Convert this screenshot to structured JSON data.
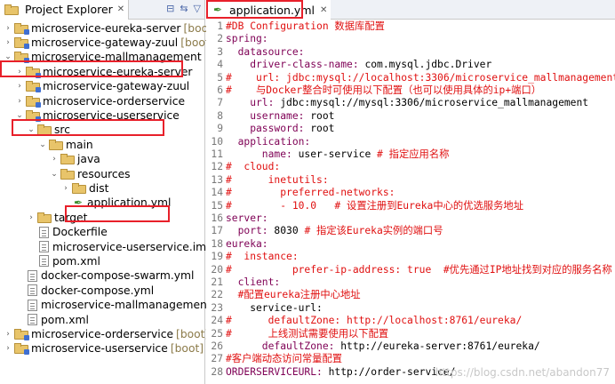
{
  "explorer": {
    "title": "Project Explorer",
    "close": "✕",
    "items": [
      {
        "label": "microservice-eureka-server",
        "suffix": "[boot]",
        "type": "proj",
        "level": 0,
        "twist": "›"
      },
      {
        "label": "microservice-gateway-zuul",
        "suffix": "[boot]",
        "type": "proj",
        "level": 0,
        "twist": "›"
      },
      {
        "label": "microservice-mallmanagement",
        "suffix": "",
        "type": "proj",
        "level": 0,
        "twist": "⌄"
      },
      {
        "label": "microservice-eureka-server",
        "suffix": "",
        "type": "proj",
        "level": 1,
        "twist": "›"
      },
      {
        "label": "microservice-gateway-zuul",
        "suffix": "",
        "type": "proj",
        "level": 1,
        "twist": "›"
      },
      {
        "label": "microservice-orderservice",
        "suffix": "",
        "type": "proj",
        "level": 1,
        "twist": "›"
      },
      {
        "label": "microservice-userservice",
        "suffix": "",
        "type": "proj",
        "level": 1,
        "twist": "⌄"
      },
      {
        "label": "src",
        "suffix": "",
        "type": "folder",
        "level": 2,
        "twist": "⌄"
      },
      {
        "label": "main",
        "suffix": "",
        "type": "folder",
        "level": 3,
        "twist": "⌄"
      },
      {
        "label": "java",
        "suffix": "",
        "type": "folder",
        "level": 4,
        "twist": "›"
      },
      {
        "label": "resources",
        "suffix": "",
        "type": "folder",
        "level": 4,
        "twist": "⌄"
      },
      {
        "label": "dist",
        "suffix": "",
        "type": "folder",
        "level": 5,
        "twist": "›"
      },
      {
        "label": "application.yml",
        "suffix": "",
        "type": "yml",
        "level": 5,
        "twist": ""
      },
      {
        "label": "target",
        "suffix": "",
        "type": "folder",
        "level": 2,
        "twist": "›"
      },
      {
        "label": "Dockerfile",
        "suffix": "",
        "type": "file",
        "level": 2,
        "twist": ""
      },
      {
        "label": "microservice-userservice.iml",
        "suffix": "",
        "type": "file",
        "level": 2,
        "twist": ""
      },
      {
        "label": "pom.xml",
        "suffix": "",
        "type": "file",
        "level": 2,
        "twist": ""
      },
      {
        "label": "docker-compose-swarm.yml",
        "suffix": "",
        "type": "file",
        "level": 1,
        "twist": ""
      },
      {
        "label": "docker-compose.yml",
        "suffix": "",
        "type": "file",
        "level": 1,
        "twist": ""
      },
      {
        "label": "microservice-mallmanagement.iml",
        "suffix": "",
        "type": "file",
        "level": 1,
        "twist": ""
      },
      {
        "label": "pom.xml",
        "suffix": "",
        "type": "file",
        "level": 1,
        "twist": ""
      },
      {
        "label": "microservice-orderservice",
        "suffix": "[boot]",
        "type": "proj",
        "level": 0,
        "twist": "›"
      },
      {
        "label": "microservice-userservice",
        "suffix": "[boot]",
        "type": "proj",
        "level": 0,
        "twist": "›"
      }
    ]
  },
  "editor": {
    "tab_label": "application.yml",
    "close": "✕",
    "lines": [
      [
        [
          "#DB Configuration 数据库配置",
          "red"
        ]
      ],
      [
        [
          "spring:",
          "key"
        ]
      ],
      [
        [
          "  datasource:",
          "key"
        ]
      ],
      [
        [
          "    driver-class-name: ",
          "key"
        ],
        [
          "com.mysql.jdbc.Driver",
          "plain"
        ]
      ],
      [
        [
          "#    url: jdbc:mysql://localhost:3306/microservice_mallmanagement",
          "red"
        ]
      ],
      [
        [
          "#    与Docker整合时可使用以下配置（也可以使用具体的ip+端口）",
          "red"
        ]
      ],
      [
        [
          "    url: ",
          "key"
        ],
        [
          "jdbc:mysql://mysql:3306/microservice_mallmanagement",
          "plain"
        ]
      ],
      [
        [
          "    username: ",
          "key"
        ],
        [
          "root",
          "plain"
        ]
      ],
      [
        [
          "    password: ",
          "key"
        ],
        [
          "root",
          "plain"
        ]
      ],
      [
        [
          "  application:",
          "key"
        ]
      ],
      [
        [
          "      name: ",
          "key"
        ],
        [
          "user-service ",
          "plain"
        ],
        [
          "# 指定应用名称",
          "red"
        ]
      ],
      [
        [
          "#  cloud:",
          "red"
        ]
      ],
      [
        [
          "#      inetutils:",
          "red"
        ]
      ],
      [
        [
          "#        preferred-networks:",
          "red"
        ]
      ],
      [
        [
          "#        - 10.0   # 设置注册到Eureka中心的优选服务地址",
          "red"
        ]
      ],
      [
        [
          "server:",
          "key"
        ]
      ],
      [
        [
          "  port: ",
          "key"
        ],
        [
          "8030 ",
          "plain"
        ],
        [
          "# 指定该Eureka实例的端口号",
          "red"
        ]
      ],
      [
        [
          "eureka:",
          "key"
        ]
      ],
      [
        [
          "#  instance:",
          "red"
        ]
      ],
      [
        [
          "#          prefer-ip-address: true  #优先通过IP地址找到对应的服务名称",
          "red"
        ]
      ],
      [
        [
          "  client:",
          "key"
        ]
      ],
      [
        [
          "  #配置eureka注册中心地址",
          "red"
        ]
      ],
      [
        [
          "    service-url:",
          "plain"
        ]
      ],
      [
        [
          "#      defaultZone: http://localhost:8761/eureka/",
          "red"
        ]
      ],
      [
        [
          "#      上线测试需要使用以下配置",
          "red"
        ]
      ],
      [
        [
          "      defaultZone: ",
          "key"
        ],
        [
          "http://eureka-server:8761/eureka/",
          "plain"
        ]
      ],
      [
        [
          "#客户端动态访问常量配置",
          "red"
        ]
      ],
      [
        [
          "ORDERSERVICEURL: ",
          "key"
        ],
        [
          "http://order-service/",
          "plain"
        ]
      ]
    ]
  },
  "watermark": "https://blog.csdn.net/abandon77",
  "colors": {
    "highlight": "#e8202a",
    "key": "#7f0055",
    "comment": "#e01010"
  }
}
